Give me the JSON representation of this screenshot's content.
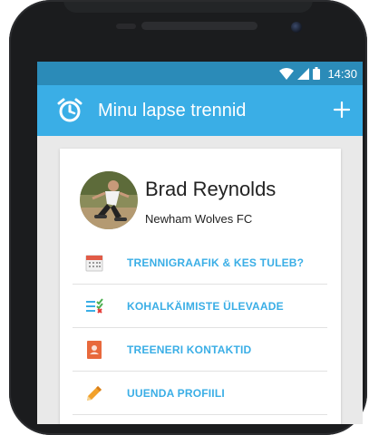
{
  "status_bar": {
    "time": "14:30",
    "icons": [
      "wifi-icon",
      "signal-icon",
      "battery-icon"
    ]
  },
  "app_bar": {
    "icon": "stopwatch-icon",
    "title": "Minu lapse trennid",
    "action_icon": "add-icon"
  },
  "profile": {
    "name": "Brad Reynolds",
    "club": "Newham Wolves FC",
    "avatar_icon": "avatar-photo"
  },
  "menu": {
    "items": [
      {
        "label": "TRENNIGRAAFIK & KES TULEB?",
        "icon": "calendar-icon"
      },
      {
        "label": "KOHALKÄIMISTE ÜLEVAADE",
        "icon": "attendance-list-icon"
      },
      {
        "label": "TREENERI KONTAKTID",
        "icon": "contact-card-icon"
      },
      {
        "label": "UUENDA PROFIILI",
        "icon": "pencil-icon"
      }
    ]
  },
  "colors": {
    "accent": "#3aaee6",
    "status_bar": "#2b8bb8",
    "screen_background": "#e9e9e9",
    "calendar_red": "#e15b47",
    "check_green": "#4caf50",
    "cross_red": "#e53935",
    "contact_orange": "#e8693c",
    "pencil_orange": "#f2a12b"
  }
}
